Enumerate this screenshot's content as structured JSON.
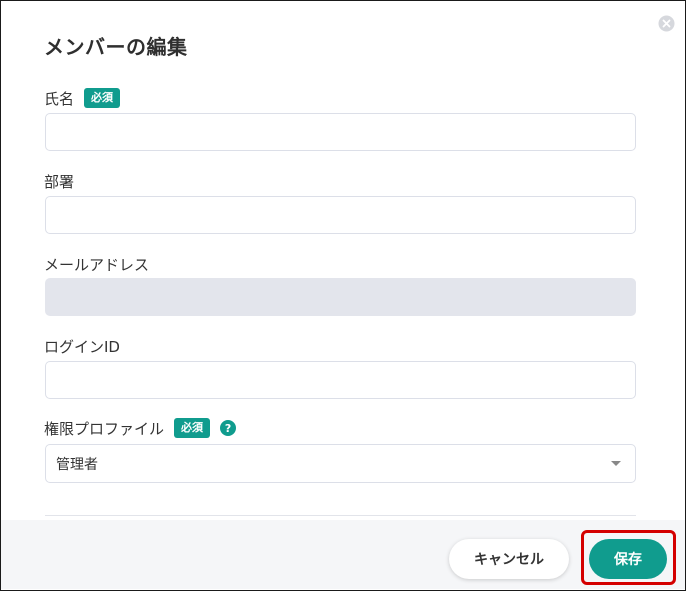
{
  "dialog": {
    "title": "メンバーの編集",
    "close_icon": "close-circle-icon"
  },
  "fields": {
    "name": {
      "label": "氏名",
      "badge": "必須",
      "value": "",
      "placeholder": ""
    },
    "department": {
      "label": "部署",
      "value": ""
    },
    "email": {
      "label": "メールアドレス",
      "value": "",
      "disabled": true
    },
    "login_id": {
      "label": "ログインID",
      "value": ""
    },
    "profile": {
      "label": "権限プロファイル",
      "badge": "必須",
      "help_icon": "?",
      "selected": "管理者"
    }
  },
  "footer": {
    "cancel_label": "キャンセル",
    "save_label": "保存"
  },
  "colors": {
    "accent": "#109c8e",
    "highlight": "#d40000",
    "disabled_bg": "#e3e5ec"
  }
}
